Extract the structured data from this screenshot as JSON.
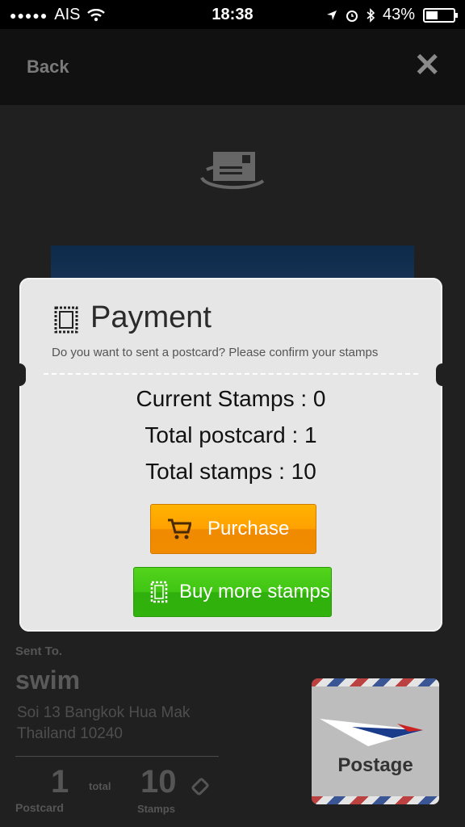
{
  "status_bar": {
    "carrier": "AIS",
    "time": "18:38",
    "battery": "43%"
  },
  "nav": {
    "back_label": "Back"
  },
  "background_card": {
    "sent_to_label": "Sent To.",
    "recipient_name": "swim",
    "address_line1": "Soi 13 Bangkok Hua Mak",
    "address_line2": "Thailand 10240",
    "postcard_count": "1",
    "postcard_label": "Postcard",
    "total_label": "total",
    "stamps_count": "10",
    "stamps_label": "Stamps",
    "postage_label": "Postage"
  },
  "dialog": {
    "title": "Payment",
    "subtitle": "Do you want to sent a postcard? Please confirm your stamps",
    "current_stamps": "Current Stamps : 0",
    "total_postcard": "Total postcard : 1",
    "total_stamps": "Total stamps : 10",
    "purchase_label": "Purchase",
    "buy_more_label": "Buy more stamps"
  },
  "colors": {
    "purchase": "#ffa000",
    "buy_more": "#3cc014",
    "dialog_bg": "#e6e6e6"
  },
  "icons": [
    "signal-dots-icon",
    "wifi-icon",
    "location-icon",
    "alarm-icon",
    "bluetooth-icon",
    "battery-icon",
    "close-icon",
    "mail-rotate-icon",
    "stamp-icon",
    "cart-icon",
    "tag-icon"
  ]
}
